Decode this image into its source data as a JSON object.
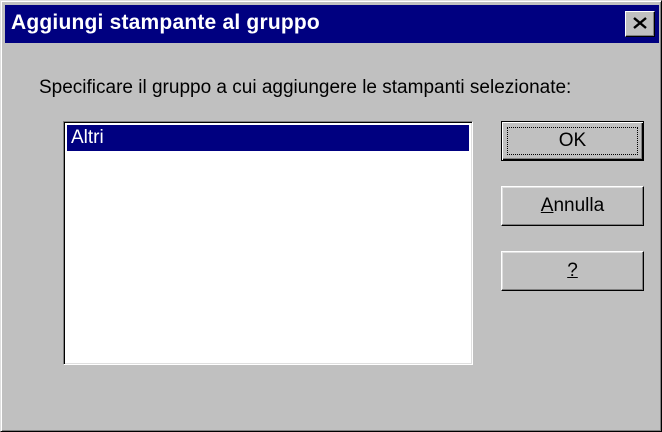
{
  "window": {
    "title": "Aggiungi stampante al gruppo"
  },
  "prompt": "Specificare il gruppo a cui aggiungere le stampanti selezionate:",
  "group_list": {
    "items": [
      {
        "label": "Altri",
        "selected": true
      }
    ]
  },
  "buttons": {
    "ok": {
      "label": "OK"
    },
    "cancel": {
      "label_mnemonic": "A",
      "label_rest": "nnulla"
    },
    "help": {
      "label": "?"
    }
  },
  "icons": {
    "close": "close-icon"
  },
  "colors": {
    "titlebar": "#000080",
    "face": "#c0c0c0",
    "selection": "#000080"
  }
}
